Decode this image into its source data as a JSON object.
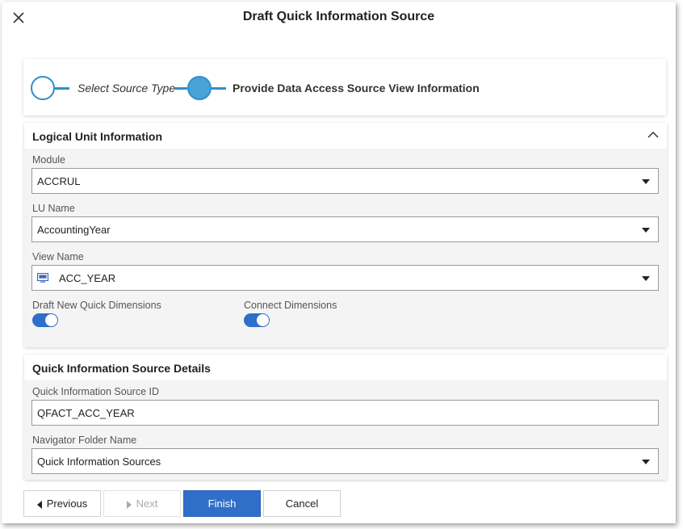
{
  "dialog": {
    "title": "Draft Quick Information Source"
  },
  "icons": {
    "close": "close-icon",
    "collapse": "chevron-up-icon",
    "view": "view-icon",
    "dropdown": "caret-down-icon"
  },
  "colors": {
    "accent": "#2f8fc9",
    "primary_button": "#2f6fc9",
    "toggle_on": "#2f6fc9"
  },
  "stepper": {
    "steps": [
      {
        "label": "Select Source Type",
        "state": "completed"
      },
      {
        "label": "Provide Data Access Source View Information",
        "state": "active"
      }
    ]
  },
  "logical_unit": {
    "title": "Logical Unit Information",
    "module_label": "Module",
    "module_value": "ACCRUL",
    "lu_label": "LU Name",
    "lu_value": "AccountingYear",
    "view_label": "View Name",
    "view_value": "ACC_YEAR",
    "draft_dims_label": "Draft New Quick Dimensions",
    "draft_dims_on": true,
    "connect_dims_label": "Connect Dimensions",
    "connect_dims_on": true
  },
  "qis_details": {
    "title": "Quick Information Source Details",
    "id_label": "Quick Information Source ID",
    "id_value": "QFACT_ACC_YEAR",
    "folder_label": "Navigator Folder Name",
    "folder_value": "Quick Information Sources"
  },
  "footer": {
    "previous": "Previous",
    "next": "Next",
    "finish": "Finish",
    "cancel": "Cancel"
  }
}
